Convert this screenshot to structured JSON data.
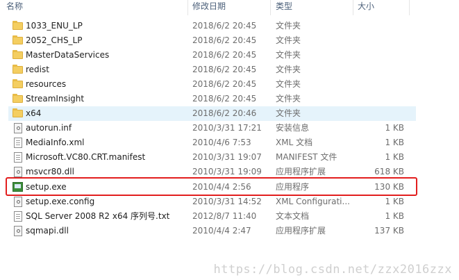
{
  "header": {
    "name": "名称",
    "date": "修改日期",
    "type": "类型",
    "size": "大小"
  },
  "files": [
    {
      "name": "1033_ENU_LP",
      "date": "2018/6/2 20:45",
      "type": "文件夹",
      "size": "",
      "icon": "folder-icon"
    },
    {
      "name": "2052_CHS_LP",
      "date": "2018/6/2 20:45",
      "type": "文件夹",
      "size": "",
      "icon": "folder-icon"
    },
    {
      "name": "MasterDataServices",
      "date": "2018/6/2 20:45",
      "type": "文件夹",
      "size": "",
      "icon": "folder-icon"
    },
    {
      "name": "redist",
      "date": "2018/6/2 20:45",
      "type": "文件夹",
      "size": "",
      "icon": "folder-icon"
    },
    {
      "name": "resources",
      "date": "2018/6/2 20:45",
      "type": "文件夹",
      "size": "",
      "icon": "folder-icon"
    },
    {
      "name": "StreamInsight",
      "date": "2018/6/2 20:45",
      "type": "文件夹",
      "size": "",
      "icon": "folder-icon"
    },
    {
      "name": "x64",
      "date": "2018/6/2 20:46",
      "type": "文件夹",
      "size": "",
      "icon": "folder-icon",
      "selected": true
    },
    {
      "name": "autorun.inf",
      "date": "2010/3/31 17:21",
      "type": "安装信息",
      "size": "1 KB",
      "icon": "settings-file-icon"
    },
    {
      "name": "MediaInfo.xml",
      "date": "2010/4/6 7:53",
      "type": "XML 文档",
      "size": "1 KB",
      "icon": "document-icon"
    },
    {
      "name": "Microsoft.VC80.CRT.manifest",
      "date": "2010/3/31 19:07",
      "type": "MANIFEST 文件",
      "size": "1 KB",
      "icon": "document-icon"
    },
    {
      "name": "msvcr80.dll",
      "date": "2010/3/31 19:09",
      "type": "应用程序扩展",
      "size": "618 KB",
      "icon": "dll-icon"
    },
    {
      "name": "setup.exe",
      "date": "2010/4/4 2:56",
      "type": "应用程序",
      "size": "130 KB",
      "icon": "exe-icon"
    },
    {
      "name": "setup.exe.config",
      "date": "2010/3/31 14:52",
      "type": "XML Configurati...",
      "size": "1 KB",
      "icon": "config-file-icon"
    },
    {
      "name": "SQL Server 2008 R2 x64 序列号.txt",
      "date": "2012/8/7 11:40",
      "type": "文本文档",
      "size": "1 KB",
      "icon": "document-icon"
    },
    {
      "name": "sqmapi.dll",
      "date": "2010/4/4 2:47",
      "type": "应用程序扩展",
      "size": "137 KB",
      "icon": "dll-icon"
    }
  ],
  "watermark": "https://blog.csdn.net/zzx2016zzx",
  "colors": {
    "highlight": "#e21e1e",
    "selected_row": "#e5f3fb",
    "folder": "#f4ce61"
  }
}
